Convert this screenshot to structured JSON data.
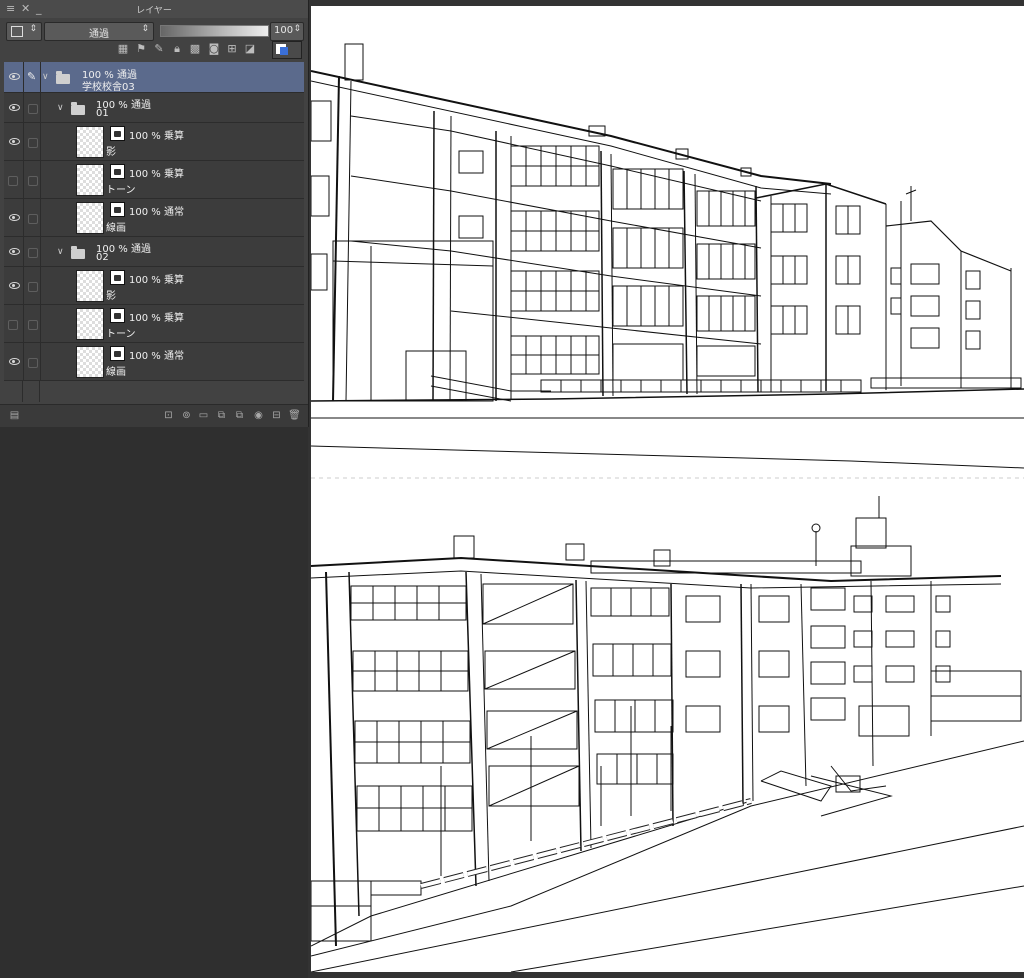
{
  "panel": {
    "title": "レイヤー",
    "blend_mode": "通過",
    "opacity_value": "100",
    "opacity_level": 1.0
  },
  "layers": [
    {
      "opacity_mode": "100 % 通過",
      "name": "学校校舎03",
      "type": "folder",
      "visible": true,
      "selected": true,
      "expanded": true
    },
    {
      "opacity_mode": "100 % 通過",
      "name": "01",
      "type": "folder",
      "visible": true,
      "selected": false,
      "expanded": true
    },
    {
      "opacity_mode": "100 % 乗算",
      "name": "影",
      "type": "layer",
      "visible": true,
      "selected": false
    },
    {
      "opacity_mode": "100 % 乗算",
      "name": "トーン",
      "type": "layer",
      "visible": false,
      "selected": false
    },
    {
      "opacity_mode": "100 % 通常",
      "name": "線画",
      "type": "layer",
      "visible": true,
      "selected": false
    },
    {
      "opacity_mode": "100 % 通過",
      "name": "02",
      "type": "folder",
      "visible": true,
      "selected": false,
      "expanded": true
    },
    {
      "opacity_mode": "100 % 乗算",
      "name": "影",
      "type": "layer",
      "visible": true,
      "selected": false
    },
    {
      "opacity_mode": "100 % 乗算",
      "name": "トーン",
      "type": "layer",
      "visible": false,
      "selected": false
    },
    {
      "opacity_mode": "100 % 通常",
      "name": "線画",
      "type": "layer",
      "visible": true,
      "selected": false
    }
  ],
  "icons": {
    "titlebar": [
      "menu-icon",
      "close-icon",
      "minimize-icon"
    ],
    "toolbar": [
      "layer-clip-icon",
      "reference-layer-icon",
      "draft-layer-icon",
      "lock-icon",
      "lock-transparency-icon",
      "mask-enable-icon",
      "ruler-icon",
      "layer-color-icon"
    ],
    "bottom": [
      "panel-menu-icon",
      "new-raster-layer-icon",
      "new-vector-layer-icon",
      "new-folder-icon",
      "transfer-down-icon",
      "combine-down-icon",
      "create-mask-icon",
      "apply-mask-icon",
      "delete-layer-icon"
    ]
  },
  "colors": {
    "selected_row": "#5b6a8c",
    "panel_bg": "#424242",
    "canvas_bg": "#ffffff"
  }
}
